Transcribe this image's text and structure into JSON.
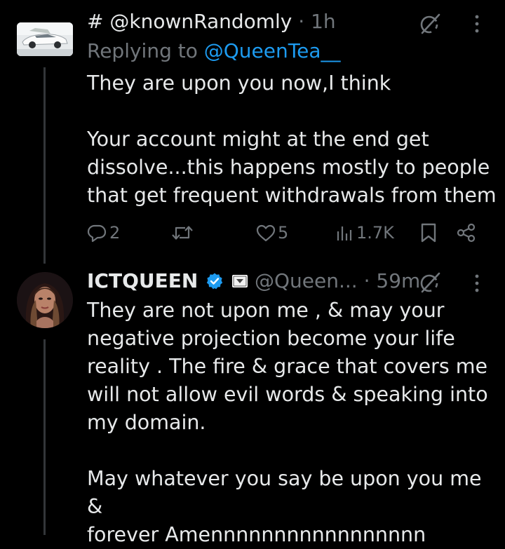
{
  "tweet1": {
    "handle_line": "# @knownRandomly",
    "sep": "·",
    "time": "1h",
    "replying_prefix": "Replying to",
    "replying_to": "@QueenTea__",
    "lines": [
      "They are upon you now,I think",
      "",
      "Your account might at the end get",
      "dissolve...this happens mostly to people",
      "that get frequent withdrawals from them"
    ],
    "actions": {
      "replies": "2",
      "retweets": "",
      "likes": "5",
      "views": "1.7K"
    }
  },
  "tweet2": {
    "name": "ICTQUEEN",
    "handle": "@Queen...",
    "sep": "·",
    "time": "59m",
    "lines": [
      "They are not upon me , & may your",
      "negative projection become your life",
      "reality . The fire & grace that covers me",
      "will not allow evil words & speaking into",
      "my domain.",
      "",
      "May whatever you say be upon you me &",
      "forever Amennnnnnnnnnnnnnnnn"
    ]
  },
  "icons": {
    "grok": "grok-icon",
    "more": "more-icon",
    "reply": "reply-icon",
    "retweet": "retweet-icon",
    "like": "like-icon",
    "views": "views-icon",
    "bookmark": "bookmark-icon",
    "share": "share-icon",
    "verified": "verified-badge-icon",
    "affiliate": "affiliate-badge-icon"
  },
  "colors": {
    "background": "#000000",
    "text": "#e7e9ea",
    "muted": "#71767b",
    "link": "#1d9bf0",
    "verified": "#1d9bf0"
  }
}
